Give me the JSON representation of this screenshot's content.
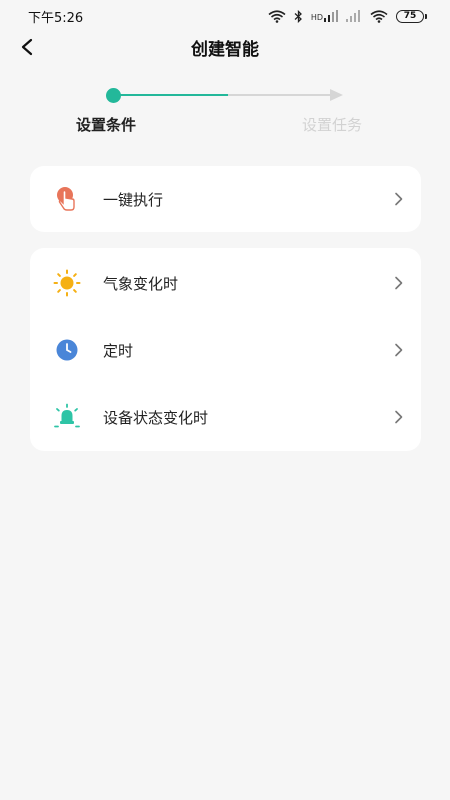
{
  "status_bar": {
    "time": "下午5:26",
    "network_label": "HD",
    "battery": "75"
  },
  "header": {
    "title": "创建智能"
  },
  "stepper": {
    "steps": [
      {
        "label": "设置条件",
        "active": true
      },
      {
        "label": "设置任务",
        "active": false
      }
    ]
  },
  "cards": [
    {
      "items": [
        {
          "label": "一键执行",
          "icon": "hand-tap-icon",
          "icon_color": "#e8755a"
        }
      ]
    },
    {
      "items": [
        {
          "label": "气象变化时",
          "icon": "sun-icon",
          "icon_color": "#f5b014"
        },
        {
          "label": "定时",
          "icon": "clock-icon",
          "icon_color": "#4a86d8"
        },
        {
          "label": "设备状态变化时",
          "icon": "device-light-icon",
          "icon_color": "#2ec4a6"
        }
      ]
    }
  ],
  "colors": {
    "accent": "#23b89a",
    "inactive": "#d6d6d6",
    "background": "#f6f6f6"
  }
}
